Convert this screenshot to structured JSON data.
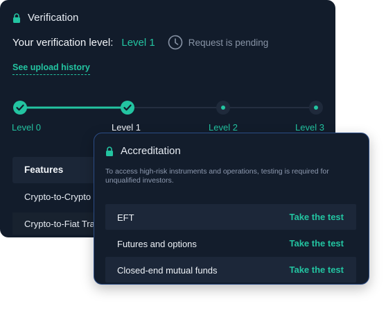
{
  "verification": {
    "title": "Verification",
    "level_label": "Your verification level:",
    "level_value": "Level 1",
    "pending_text": "Request is pending",
    "upload_link": "See upload history",
    "levels": [
      "Level 0",
      "Level 1",
      "Level 2",
      "Level 3"
    ],
    "current_level_index": 1,
    "features_header": "Features",
    "features": [
      "Crypto-to-Crypto",
      "Crypto-to-Fiat Tra"
    ]
  },
  "accreditation": {
    "title": "Accreditation",
    "description": "To access high-risk instruments and operations, testing is required for unqualified investors.",
    "rows": [
      {
        "name": "EFT",
        "action": "Take the test"
      },
      {
        "name": "Futures and options",
        "action": "Take the test"
      },
      {
        "name": "Closed-end mutual funds",
        "action": "Take the test"
      }
    ]
  },
  "colors": {
    "accent": "#23c4a1",
    "card_bg": "#121c2b",
    "muted": "#8894a6",
    "border_blue": "#2c4d86"
  },
  "icons": [
    "lock-icon",
    "clock-icon",
    "check-icon"
  ]
}
